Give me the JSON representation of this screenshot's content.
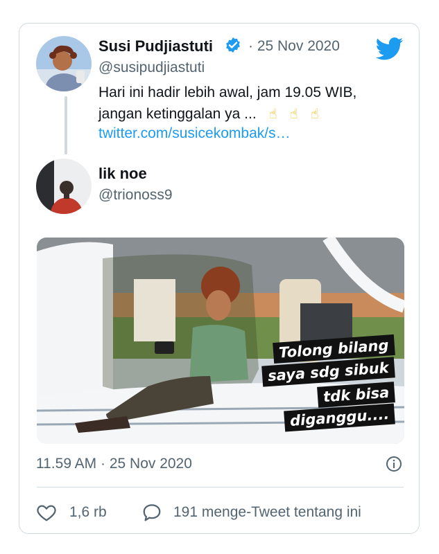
{
  "quoted_tweet": {
    "author_name": "Susi Pudjiastuti",
    "date": "· 25 Nov 2020",
    "handle": "@susipudjiastuti",
    "text_line1": "Hari ini hadir lebih awal, jam 19.05 WIB,",
    "text_line2": "jangan ketinggalan ya ...",
    "emojis": [
      "☝",
      "☝",
      "☝"
    ],
    "link": "twitter.com/susicekombak/s…"
  },
  "reply": {
    "author_name": "lik noe",
    "handle": "@trionoss9",
    "image_caption": [
      "Tolong bilang",
      "saya sdg sibuk",
      "tdk bisa",
      "diganggu...."
    ]
  },
  "footer": {
    "timestamp": "11.59 AM · 25 Nov 2020",
    "like_count": "1,6 rb",
    "retweet_text": "191 menge-Tweet tentang ini"
  },
  "colors": {
    "accent": "#1d9bf0",
    "secondary_text": "#536471",
    "border": "#cfd9de"
  },
  "icons": {
    "verified": "verified-badge-icon",
    "brand": "twitter-bird-icon",
    "info": "info-icon",
    "like": "heart-icon",
    "reply": "speech-bubble-icon"
  }
}
